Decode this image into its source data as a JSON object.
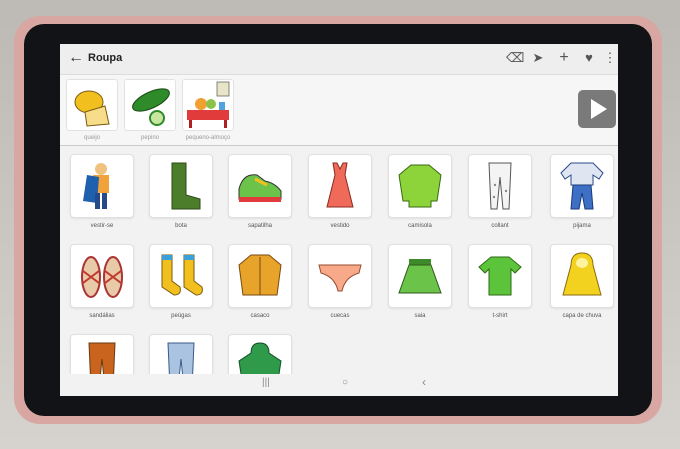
{
  "app": {
    "title": "Roupa"
  },
  "toolbar": {
    "back_icon": "←",
    "delete_icon": "⌫",
    "send_icon": "➤",
    "add_icon": "+",
    "favorite_icon": "♥",
    "more_icon": "⋮"
  },
  "sentence": {
    "items": [
      {
        "label": "queijo",
        "icon": "cheese-icon"
      },
      {
        "label": "pepino",
        "icon": "cucumber-icon"
      },
      {
        "label": "pequeno-almoço",
        "icon": "breakfast-icon"
      }
    ],
    "play_icon": "play-icon"
  },
  "grid": {
    "items": [
      {
        "label": "vestir-se"
      },
      {
        "label": "bota"
      },
      {
        "label": "sapatilha"
      },
      {
        "label": "vestido"
      },
      {
        "label": "camisola"
      },
      {
        "label": "collant"
      },
      {
        "label": "pijama"
      },
      {
        "label": "sandálias"
      },
      {
        "label": "peúgas"
      },
      {
        "label": "casaco"
      },
      {
        "label": "cuecas"
      },
      {
        "label": "saia"
      },
      {
        "label": "t-shirt"
      },
      {
        "label": "capa de chuva"
      },
      {
        "label": ""
      },
      {
        "label": ""
      },
      {
        "label": ""
      }
    ]
  },
  "navbar": {
    "recents": "|||",
    "home": "○",
    "back": "‹"
  },
  "colors": {
    "case": "#d8a7a2",
    "play_button": "#7a7a7a",
    "green_clothes": "#6cc34a",
    "yellow": "#f2c01e"
  }
}
